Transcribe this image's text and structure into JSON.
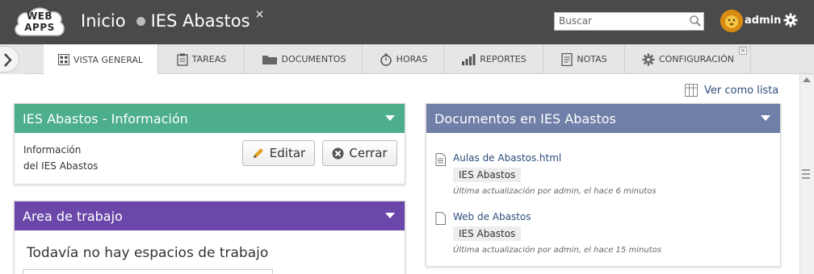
{
  "logo": {
    "line1": "WEB",
    "line2": "APPS"
  },
  "header": {
    "section": "Inicio",
    "project": "IES Abastos",
    "close_glyph": "×"
  },
  "search": {
    "placeholder": "Buscar"
  },
  "user": {
    "name": "admin"
  },
  "tabs": [
    {
      "label": "VISTA GENERAL",
      "icon": "grid-icon"
    },
    {
      "label": "TAREAS",
      "icon": "clipboard-icon"
    },
    {
      "label": "DOCUMENTOS",
      "icon": "folder-icon"
    },
    {
      "label": "HORAS",
      "icon": "stopwatch-icon"
    },
    {
      "label": "REPORTES",
      "icon": "bar-chart-icon"
    },
    {
      "label": "NOTAS",
      "icon": "note-icon"
    },
    {
      "label": "CONFIGURACIÓN",
      "icon": "gear-icon"
    }
  ],
  "view_toggle": {
    "label": "Ver como lista"
  },
  "info_panel": {
    "title": "IES Abastos - Información",
    "text_line1": "Información",
    "text_line2": "del IES Abastos",
    "edit_label": "Editar",
    "close_label": "Cerrar"
  },
  "workspace_panel": {
    "title": "Area de trabajo",
    "empty_text": "Todavía no hay espacios de trabajo"
  },
  "docs_panel": {
    "title": "Documentos en IES Abastos",
    "items": [
      {
        "name": "Aulas de Abastos.html",
        "tag": "IES Abastos",
        "meta": "Última actualización por admin, el hace 6 minutos"
      },
      {
        "name": "Web de Abastos",
        "tag": "IES Abastos",
        "meta": "Última actualización por admin, el hace 15 minutos"
      }
    ]
  },
  "colors": {
    "topbar": "#4a4a4a",
    "info_header": "#4cae8a",
    "workspace_header": "#6a47a8",
    "docs_header": "#6f7fa7",
    "link": "#2c4d7a"
  }
}
